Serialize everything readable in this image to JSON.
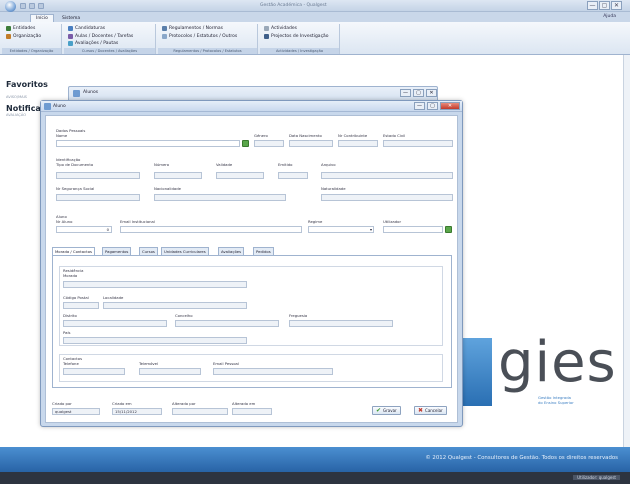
{
  "window": {
    "title": "Gestão Académica - Qualgest",
    "minimize": "—",
    "maximize": "▢",
    "close": "✕"
  },
  "ribbon_tabs": [
    {
      "label": "Início"
    },
    {
      "label": "Sistema"
    }
  ],
  "help_label": "Ajuda",
  "ribbon_groups": [
    {
      "caption": "Entidades / Organização",
      "items": [
        "Entidades",
        "Organização"
      ]
    },
    {
      "caption": "Cursos / Docentes / Avaliações",
      "items": [
        "Candidaturas",
        "Aulas / Docentes / Tarefas",
        "Avaliações / Pautas"
      ]
    },
    {
      "caption": "Regulamentos / Protocolos / Estatutos",
      "items": [
        "Regulamentos / Normas",
        "Protocolos / Estatutos / Outros"
      ]
    },
    {
      "caption": "Actividades / Investigação",
      "items": [
        "Actividades",
        "Projectos de Investigação"
      ]
    }
  ],
  "sidebar": {
    "favorites_title": "Favoritos",
    "favorites_sub": "AVISO/MAIS",
    "notifications_title": "Notificações",
    "notifications_sub": "AVALIAÇÃO"
  },
  "bg_window": {
    "title": "Alunos"
  },
  "dialog": {
    "title": "Aluno",
    "personal": {
      "section": "Dados Pessoais",
      "nome_label": "Nome",
      "genero_label": "Género",
      "data_nasc_label": "Data Nascimento",
      "contribuinte_label": "Nr Contribuinte",
      "estado_civil_label": "Estado Civil"
    },
    "identification": {
      "section": "Identificação",
      "tipo_doc_label": "Tipo de Documento",
      "numero_label": "Número",
      "validade_label": "Validade",
      "emitido_label": "Emitido",
      "arquivo_label": "Arquivo",
      "seg_social_label": "Nr Segurança Social",
      "nacionalidade_label": "Nacionalidade",
      "naturalidade_label": "Naturalidade"
    },
    "student": {
      "section": "Aluno",
      "nr_aluno_label": "Nr Aluno",
      "nr_aluno_value": "0",
      "email_label": "Email Institucional",
      "regime_label": "Regime",
      "utilizador_label": "Utilizador"
    },
    "tabs": [
      {
        "label": "Morada / Contactos"
      },
      {
        "label": "Pagamentos"
      },
      {
        "label": "Cursos"
      },
      {
        "label": "Unidades Curriculares"
      },
      {
        "label": "Avaliações"
      },
      {
        "label": "Pedidos"
      }
    ],
    "address": {
      "section": "Residência",
      "morada_label": "Morada",
      "cod_postal_label": "Código Postal",
      "localidade_label": "Localidade",
      "distrito_label": "Distrito",
      "concelho_label": "Concelho",
      "freguesia_label": "Freguesia",
      "pais_label": "País"
    },
    "contacts": {
      "section": "Contactos",
      "telefone_label": "Telefone",
      "telemovel_label": "Telemóvel",
      "email_label": "Email Pessoal"
    },
    "audit": {
      "criado_por_label": "Criado por",
      "criado_por_value": "qualgest",
      "criado_em_label": "Criado em",
      "criado_em_value": "15/11/2012",
      "alterado_por_label": "Alterado por",
      "alterado_em_label": "Alterado em"
    },
    "buttons": {
      "save": "Gravar",
      "cancel": "Cancelar"
    }
  },
  "brand": {
    "logo_word": "gies",
    "logo_sub_1": "Gestão Integrada",
    "logo_sub_2": "do Ensino Superior"
  },
  "footer": {
    "text": "© 2012 Qualgest - Consultores de Gestão. Todos os direitos reservados",
    "status_user": "Utilizador: qualgest"
  },
  "colors": {
    "accent_blue": "#2863a6",
    "save_green": "#5aa64a",
    "cancel_red": "#c0392b"
  }
}
